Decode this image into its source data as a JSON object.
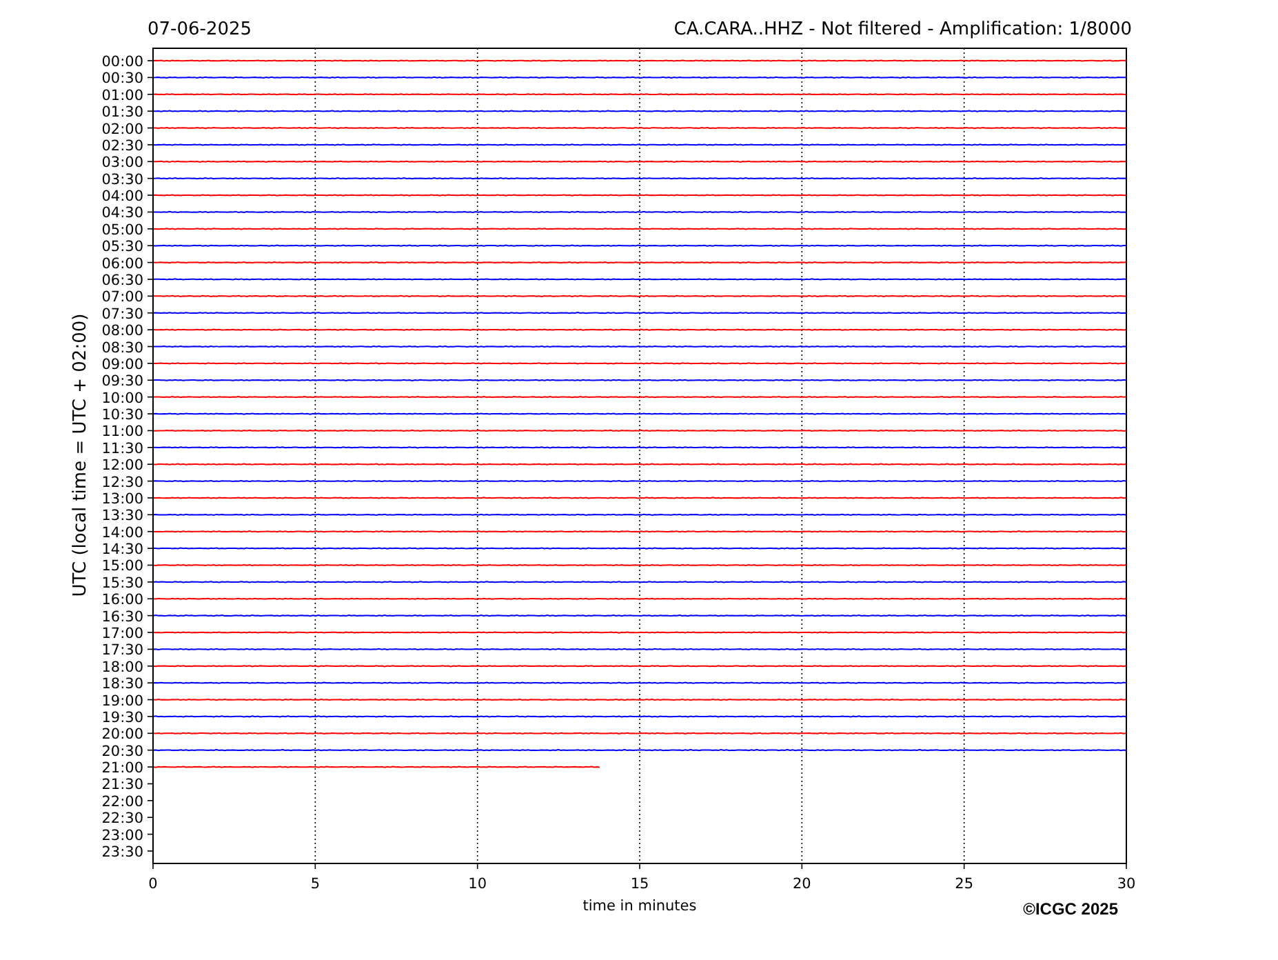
{
  "date": "07-06-2025",
  "title": "CA.CARA..HHZ - Not filtered - Amplification: 1/8000",
  "plot": {
    "xlabel": "time in minutes",
    "ylabel": "UTC (local time = UTC + 02:00)",
    "xticks": [
      "0",
      "5",
      "10",
      "15",
      "20",
      "25",
      "30"
    ]
  },
  "rows": [
    {
      "label": "00:00",
      "color": "#ff0000",
      "level": 1
    },
    {
      "label": "00:30",
      "color": "#0000ff",
      "level": 1
    },
    {
      "label": "01:00",
      "color": "#ff0000",
      "level": 1
    },
    {
      "label": "01:30",
      "color": "#0000ff",
      "level": 1
    },
    {
      "label": "02:00",
      "color": "#ff0000",
      "level": 1
    },
    {
      "label": "02:30",
      "color": "#0000ff",
      "level": 1
    },
    {
      "label": "03:00",
      "color": "#ff0000",
      "level": 1
    },
    {
      "label": "03:30",
      "color": "#0000ff",
      "level": 1
    },
    {
      "label": "04:00",
      "color": "#ff0000",
      "level": 1
    },
    {
      "label": "04:30",
      "color": "#0000ff",
      "level": 1
    },
    {
      "label": "05:00",
      "color": "#ff0000",
      "level": 1
    },
    {
      "label": "05:30",
      "color": "#0000ff",
      "level": 1
    },
    {
      "label": "06:00",
      "color": "#ff0000",
      "level": 1
    },
    {
      "label": "06:30",
      "color": "#0000ff",
      "level": 1
    },
    {
      "label": "07:00",
      "color": "#ff0000",
      "level": 1
    },
    {
      "label": "07:30",
      "color": "#0000ff",
      "level": 1
    },
    {
      "label": "08:00",
      "color": "#ff0000",
      "level": 1
    },
    {
      "label": "08:30",
      "color": "#0000ff",
      "level": 1
    },
    {
      "label": "09:00",
      "color": "#ff0000",
      "level": 1
    },
    {
      "label": "09:30",
      "color": "#0000ff",
      "level": 1
    },
    {
      "label": "10:00",
      "color": "#ff0000",
      "level": 1
    },
    {
      "label": "10:30",
      "color": "#0000ff",
      "level": 1
    },
    {
      "label": "11:00",
      "color": "#ff0000",
      "level": 1
    },
    {
      "label": "11:30",
      "color": "#0000ff",
      "level": 1
    },
    {
      "label": "12:00",
      "color": "#ff0000",
      "level": 1
    },
    {
      "label": "12:30",
      "color": "#0000ff",
      "level": 1
    },
    {
      "label": "13:00",
      "color": "#ff0000",
      "level": 1
    },
    {
      "label": "13:30",
      "color": "#0000ff",
      "level": 1
    },
    {
      "label": "14:00",
      "color": "#ff0000",
      "level": 1
    },
    {
      "label": "14:30",
      "color": "#0000ff",
      "level": 1
    },
    {
      "label": "15:00",
      "color": "#ff0000",
      "level": 1
    },
    {
      "label": "15:30",
      "color": "#0000ff",
      "level": 1
    },
    {
      "label": "16:00",
      "color": "#ff0000",
      "level": 1
    },
    {
      "label": "16:30",
      "color": "#0000ff",
      "level": 1
    },
    {
      "label": "17:00",
      "color": "#ff0000",
      "level": 1
    },
    {
      "label": "17:30",
      "color": "#0000ff",
      "level": 1
    },
    {
      "label": "18:00",
      "color": "#ff0000",
      "level": 1
    },
    {
      "label": "18:30",
      "color": "#0000ff",
      "level": 1
    },
    {
      "label": "19:00",
      "color": "#ff0000",
      "level": 1
    },
    {
      "label": "19:30",
      "color": "#0000ff",
      "level": 1
    },
    {
      "label": "20:00",
      "color": "#ff0000",
      "level": 1
    },
    {
      "label": "20:30",
      "color": "#0000ff",
      "level": 1
    },
    {
      "label": "21:00",
      "color": "#ff0000",
      "level": 0.46
    },
    {
      "label": "21:30"
    },
    {
      "label": "22:00"
    },
    {
      "label": "22:30"
    },
    {
      "label": "23:00"
    },
    {
      "label": "23:30"
    }
  ],
  "copyright": "©ICGC 2025"
}
